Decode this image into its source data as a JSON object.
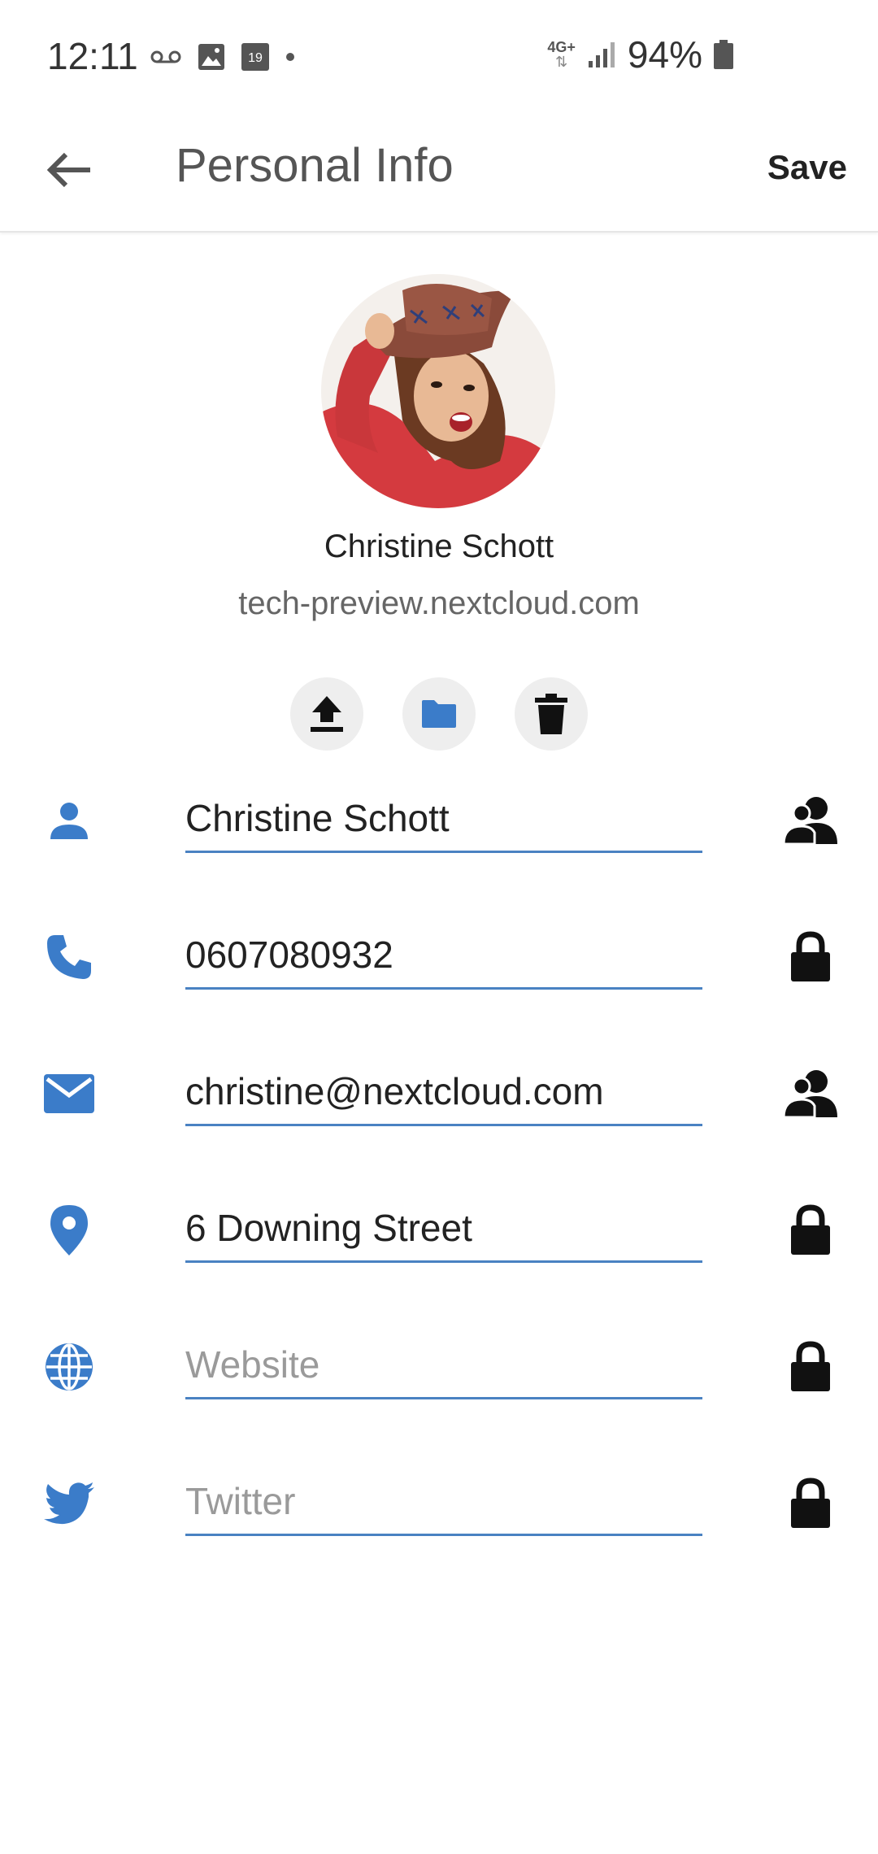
{
  "status_bar": {
    "time": "12:11",
    "network": "4G+",
    "battery": "94%",
    "calendar_day": "19",
    "icons": [
      "voicemail-icon",
      "image-icon",
      "calendar-icon",
      "dot-icon",
      "network-icon",
      "signal-icon",
      "battery-icon"
    ]
  },
  "app_bar": {
    "title": "Personal Info",
    "save_label": "Save",
    "back_icon": "arrow-left-icon"
  },
  "profile": {
    "display_name": "Christine Schott",
    "server": "tech-preview.nextcloud.com"
  },
  "avatar_actions": [
    {
      "icon": "upload-icon"
    },
    {
      "icon": "folder-icon"
    },
    {
      "icon": "trash-icon"
    }
  ],
  "fields": {
    "name": {
      "value": "Christine Schott",
      "icon": "person-icon",
      "scope_icon": "contacts-icon"
    },
    "phone": {
      "value": "0607080932",
      "icon": "phone-icon",
      "scope_icon": "lock-icon"
    },
    "email": {
      "value": "christine@nextcloud.com",
      "icon": "mail-icon",
      "scope_icon": "contacts-icon"
    },
    "address": {
      "value": "6 Downing Street",
      "icon": "location-icon",
      "scope_icon": "lock-icon"
    },
    "website": {
      "value": "",
      "placeholder": "Website",
      "icon": "globe-icon",
      "scope_icon": "lock-icon"
    },
    "twitter": {
      "value": "",
      "placeholder": "Twitter",
      "icon": "twitter-icon",
      "scope_icon": "lock-icon"
    }
  },
  "colors": {
    "accent": "#3b7cc9",
    "underline": "#4a82c2",
    "icon_dark": "#111111"
  }
}
